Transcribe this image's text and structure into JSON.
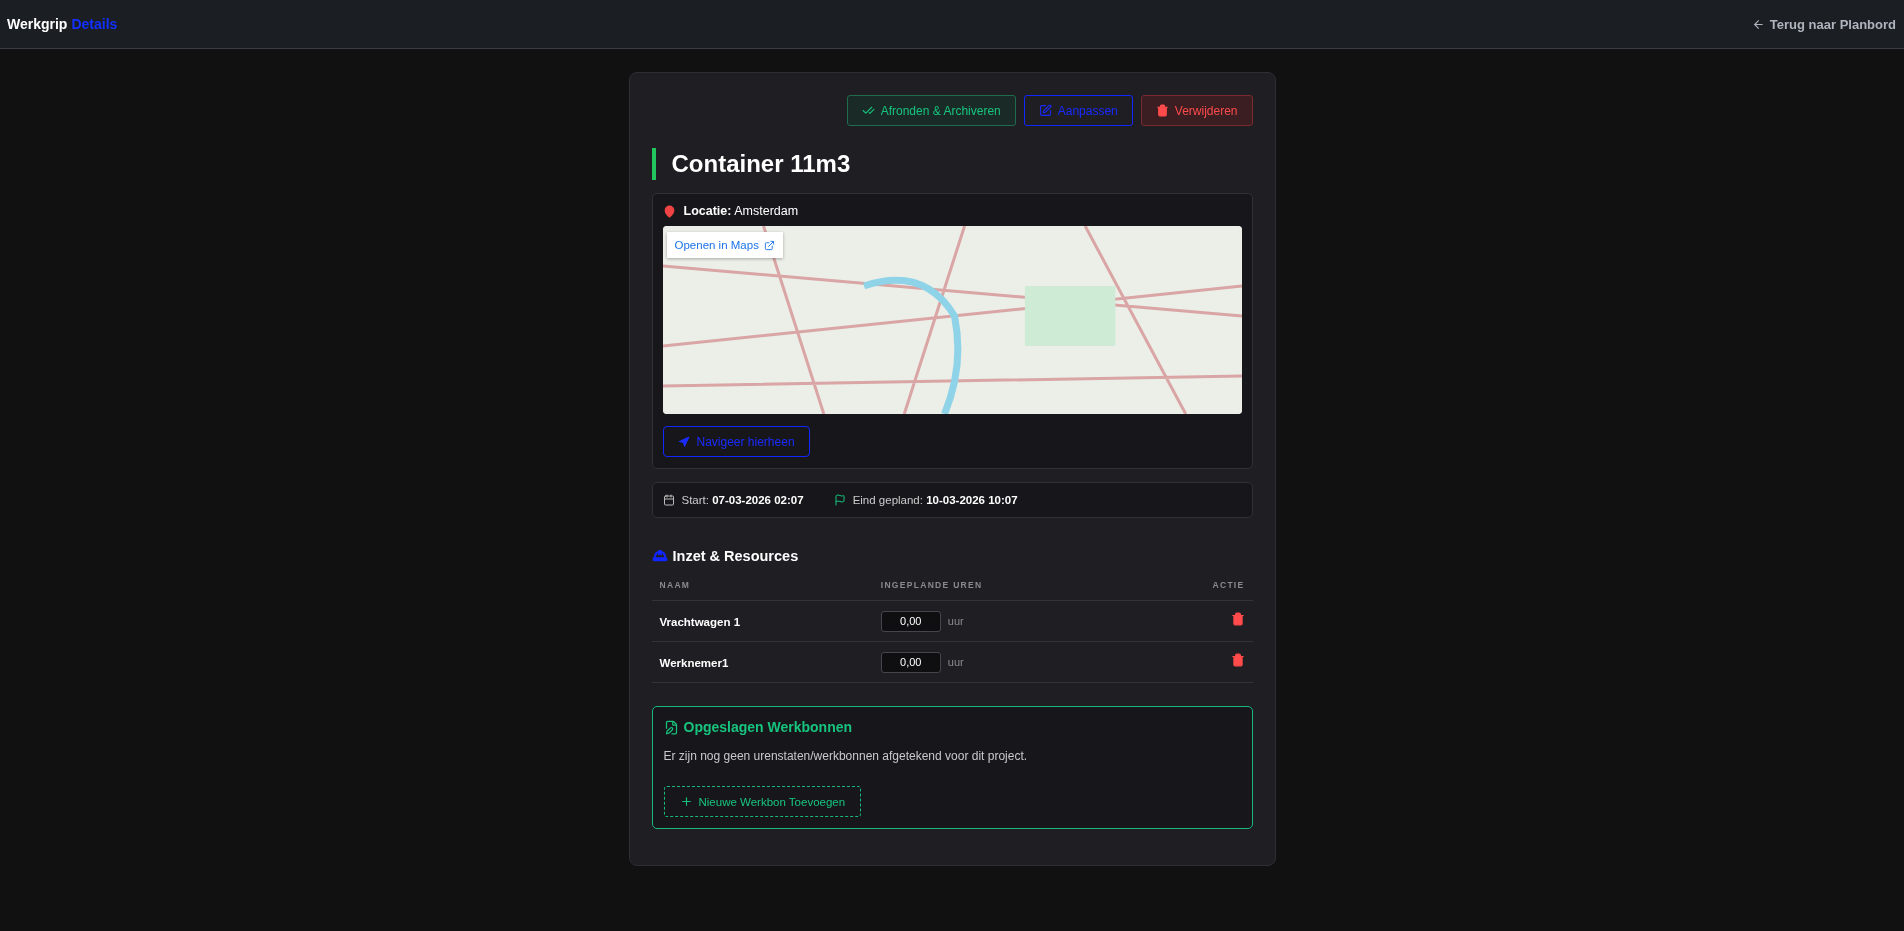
{
  "header": {
    "brand": "Werkgrip",
    "page": "Details",
    "back_link": "Terug naar Planbord"
  },
  "actions": [
    {
      "label": "Afronden & Archiveren",
      "kind": "complete"
    },
    {
      "label": "Aanpassen",
      "kind": "edit"
    },
    {
      "label": "Verwijderen",
      "kind": "delete"
    }
  ],
  "title": "Container 11m3",
  "location": {
    "label": "Locatie:",
    "value": "Amsterdam",
    "map_link": "Openen in Maps",
    "navigate": "Navigeer hierheen"
  },
  "schedule": [
    {
      "kind": "start",
      "label": "Start:",
      "value": "07-03-2026 02:07"
    },
    {
      "kind": "end",
      "label": "Eind gepland:",
      "value": "10-03-2026 10:07"
    }
  ],
  "resources": {
    "title": "Inzet & Resources",
    "columns": [
      "NAAM",
      "INGEPLANDE UREN",
      "ACTIE"
    ],
    "rows": [
      {
        "name": "Vrachtwagen 1",
        "hours": "0,00",
        "unit": "uur"
      },
      {
        "name": "Werknemer1",
        "hours": "0,00",
        "unit": "uur"
      }
    ]
  },
  "worksheets": {
    "title": "Opgeslagen Werkbonnen",
    "empty_text": "Er zijn nog geen urenstaten/werkbonnen afgetekend voor dit project.",
    "add_button": "Nieuwe Werkbon Toevoegen"
  }
}
